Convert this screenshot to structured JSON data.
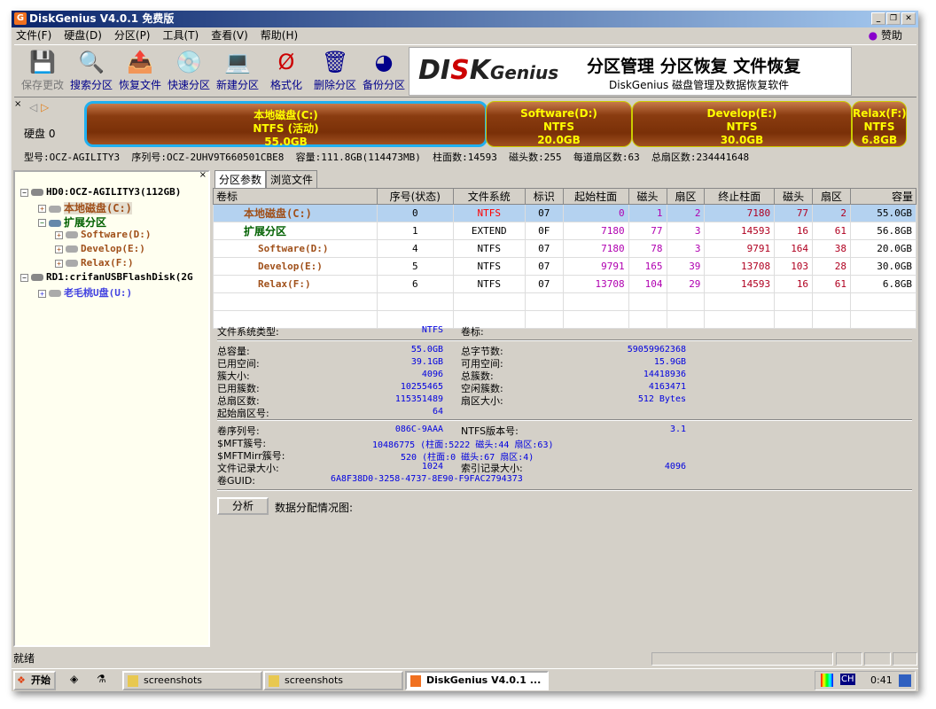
{
  "window": {
    "title": "DiskGenius V4.0.1 免费版"
  },
  "menu": [
    "文件(F)",
    "硬盘(D)",
    "分区(P)",
    "工具(T)",
    "查看(V)",
    "帮助(H)"
  ],
  "menu_sponsor": "赞助",
  "toolbar": [
    {
      "label": "保存更改",
      "icon": "save-icon",
      "enabled": false
    },
    {
      "label": "搜索分区",
      "icon": "search-icon"
    },
    {
      "label": "恢复文件",
      "icon": "recover-icon"
    },
    {
      "label": "快速分区",
      "icon": "quick-partition-icon"
    },
    {
      "label": "新建分区",
      "icon": "new-partition-icon"
    },
    {
      "label": "格式化",
      "icon": "format-icon"
    },
    {
      "label": "删除分区",
      "icon": "delete-icon"
    },
    {
      "label": "备份分区",
      "icon": "backup-icon"
    }
  ],
  "banner": {
    "logo": "DISKGenius",
    "title": "分区管理 分区恢复 文件恢复",
    "subtitle": "DiskGenius 磁盘管理及数据恢复软件"
  },
  "diskbar": {
    "disk_label": "硬盘 0",
    "partitions": [
      {
        "name": "本地磁盘(C:)",
        "fs": "NTFS (活动)",
        "size": "55.0GB"
      },
      {
        "name": "Software(D:)",
        "fs": "NTFS",
        "size": "20.0GB"
      },
      {
        "name": "Develop(E:)",
        "fs": "NTFS",
        "size": "30.0GB"
      },
      {
        "name": "Relax(F:)",
        "fs": "NTFS",
        "size": "6.8GB"
      }
    ]
  },
  "diskinfo": "型号:OCZ-AGILITY3  序列号:OCZ-2UHV9T660501CBE8  容量:111.8GB(114473MB)  柱面数:14593  磁头数:255  每道扇区数:63  总扇区数:234441648",
  "tree": [
    "HD0:OCZ-AGILITY3(112GB)",
    "本地磁盘(C:)",
    "扩展分区",
    "Software(D:)",
    "Develop(E:)",
    "Relax(F:)",
    "RD1:crifanUSBFlashDisk(2G",
    "老毛桃U盘(U:)"
  ],
  "tabs": [
    "分区参数",
    "浏览文件"
  ],
  "table": {
    "headers": [
      "卷标",
      "序号(状态)",
      "文件系统",
      "标识",
      "起始柱面",
      "磁头",
      "扇区",
      "终止柱面",
      "磁头",
      "扇区",
      "容量"
    ],
    "rows": [
      [
        "本地磁盘(C:)",
        "0",
        "NTFS",
        "07",
        "0",
        "1",
        "2",
        "7180",
        "77",
        "2",
        "55.0GB"
      ],
      [
        "扩展分区",
        "1",
        "EXTEND",
        "0F",
        "7180",
        "77",
        "3",
        "14593",
        "16",
        "61",
        "56.8GB"
      ],
      [
        "Software(D:)",
        "4",
        "NTFS",
        "07",
        "7180",
        "78",
        "3",
        "9791",
        "164",
        "38",
        "20.0GB"
      ],
      [
        "Develop(E:)",
        "5",
        "NTFS",
        "07",
        "9791",
        "165",
        "39",
        "13708",
        "103",
        "28",
        "30.0GB"
      ],
      [
        "Relax(F:)",
        "6",
        "NTFS",
        "07",
        "13708",
        "104",
        "29",
        "14593",
        "16",
        "61",
        "6.8GB"
      ]
    ]
  },
  "details": {
    "fs_type_label": "文件系统类型:",
    "fs_type": "NTFS",
    "volume_label_label": "卷标:",
    "left": [
      [
        "总容量:",
        "55.0GB"
      ],
      [
        "已用空间:",
        "39.1GB"
      ],
      [
        "簇大小:",
        "4096"
      ],
      [
        "已用簇数:",
        "10255465"
      ],
      [
        "总扇区数:",
        "115351489"
      ],
      [
        "起始扇区号:",
        "64"
      ]
    ],
    "right": [
      [
        "总字节数:",
        "59059962368"
      ],
      [
        "可用空间:",
        "15.9GB"
      ],
      [
        "总簇数:",
        "14418936"
      ],
      [
        "空闲簇数:",
        "4163471"
      ],
      [
        "扇区大小:",
        "512 Bytes"
      ]
    ],
    "serial_label": "卷序列号:",
    "serial": "086C-9AAA",
    "ntfs_ver_label": "NTFS版本号:",
    "ntfs_ver": "3.1",
    "mft_label": "$MFT簇号:",
    "mft": "10486775 (柱面:5222 磁头:44 扇区:63)",
    "mftmirr_label": "$MFTMirr簇号:",
    "mftmirr": "520 (柱面:0 磁头:67 扇区:4)",
    "rec_label": "文件记录大小:",
    "rec": "1024",
    "idx_label": "索引记录大小:",
    "idx": "4096",
    "guid_label": "卷GUID:",
    "guid": "6A8F38D0-3258-4737-8E90-F9FAC2794373",
    "analyze": "分析",
    "alloc_label": "数据分配情况图:"
  },
  "status": "就绪",
  "taskbar": {
    "start": "开始",
    "items": [
      "screenshots",
      "screenshots",
      "DiskGenius V4.0.1 ..."
    ],
    "lang": "CH",
    "clock": "0:41"
  }
}
